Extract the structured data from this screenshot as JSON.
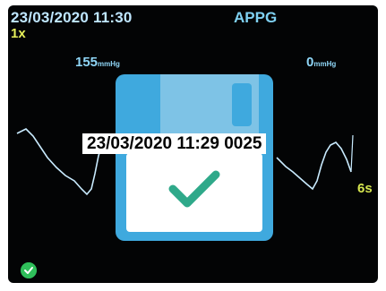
{
  "header": {
    "datetime": "23/03/2020 11:30",
    "mode": "APPG",
    "speed": "1x"
  },
  "pressure": {
    "left_value": "155",
    "right_value": "0",
    "unit": "mmHg"
  },
  "time_scale": "6s",
  "dialog": {
    "stamp": "23/03/2020 11:29 0025",
    "icon": "floppy-disk-icon",
    "check_icon": "checkmark-icon"
  },
  "status": {
    "icon": "ok-check-icon"
  },
  "colors": {
    "background": "#030405",
    "waveform": "#c9ebff",
    "dialog": "#3fa9de",
    "check": "#2fa98a"
  }
}
